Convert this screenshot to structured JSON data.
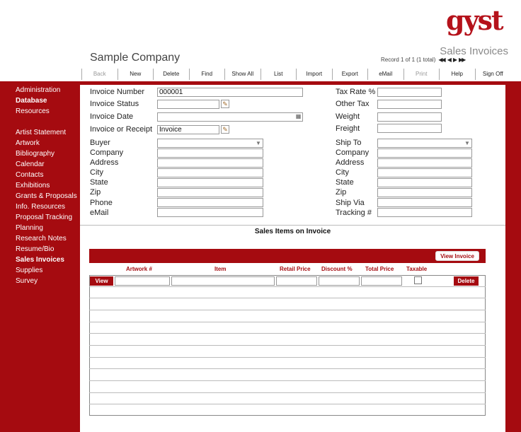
{
  "brand": {
    "logo_text": "gyst",
    "color": "#a50b10"
  },
  "header": {
    "company": "Sample Company",
    "module_title": "Sales Invoices",
    "record_text": "Record 1 of 1 (1 total)",
    "nav_icons": [
      "first-record-icon",
      "previous-record-icon",
      "next-record-icon",
      "last-record-icon"
    ]
  },
  "toolbar": {
    "back": "Back",
    "new": "New",
    "delete": "Delete",
    "find": "Find",
    "show_all": "Show All",
    "list": "List",
    "import": "Import",
    "export": "Export",
    "email": "eMail",
    "print": "Print",
    "help": "Help",
    "sign_off": "Sign Off"
  },
  "sidebar": {
    "top": [
      "Administration",
      "Database",
      "Resources"
    ],
    "modules": [
      "Artist Statement",
      "Artwork",
      "Bibliography",
      "Calendar",
      "Contacts",
      "Exhibitions",
      "Grants & Proposals",
      "Info. Resources",
      "Proposal Tracking",
      "Planning",
      "Research Notes",
      "Resume/Bio",
      "Sales Invoices",
      "Supplies",
      "Survey"
    ]
  },
  "form": {
    "invoice_number_label": "Invoice Number",
    "invoice_number": "000001",
    "invoice_status_label": "Invoice Status",
    "invoice_status": "",
    "invoice_date_label": "Invoice Date",
    "invoice_date": "",
    "invoice_or_receipt_label": "Invoice or Receipt",
    "invoice_or_receipt": "Invoice",
    "tax_rate_label": "Tax Rate %",
    "tax_rate": "",
    "other_tax_label": "Other Tax",
    "other_tax": "",
    "weight_label": "Weight",
    "weight": "",
    "freight_label": "Freight",
    "freight": "",
    "buyer": {
      "buyer_label": "Buyer",
      "company_label": "Company",
      "address_label": "Address",
      "city_label": "City",
      "state_label": "State",
      "zip_label": "Zip",
      "phone_label": "Phone",
      "email_label": "eMail"
    },
    "ship": {
      "ship_to_label": "Ship To",
      "company_label": "Company",
      "address_label": "Address",
      "city_label": "City",
      "state_label": "State",
      "zip_label": "Zip",
      "ship_via_label": "Ship Via",
      "tracking_label": "Tracking #"
    }
  },
  "items": {
    "title": "Sales Items on Invoice",
    "view_invoice": "View Invoice",
    "columns": {
      "artwork": "Artwork #",
      "item": "Item",
      "retail_price": "Retail Price",
      "discount": "Discount %",
      "total_price": "Total Price",
      "taxable": "Taxable"
    },
    "view_label": "View",
    "delete_label": "Delete"
  }
}
